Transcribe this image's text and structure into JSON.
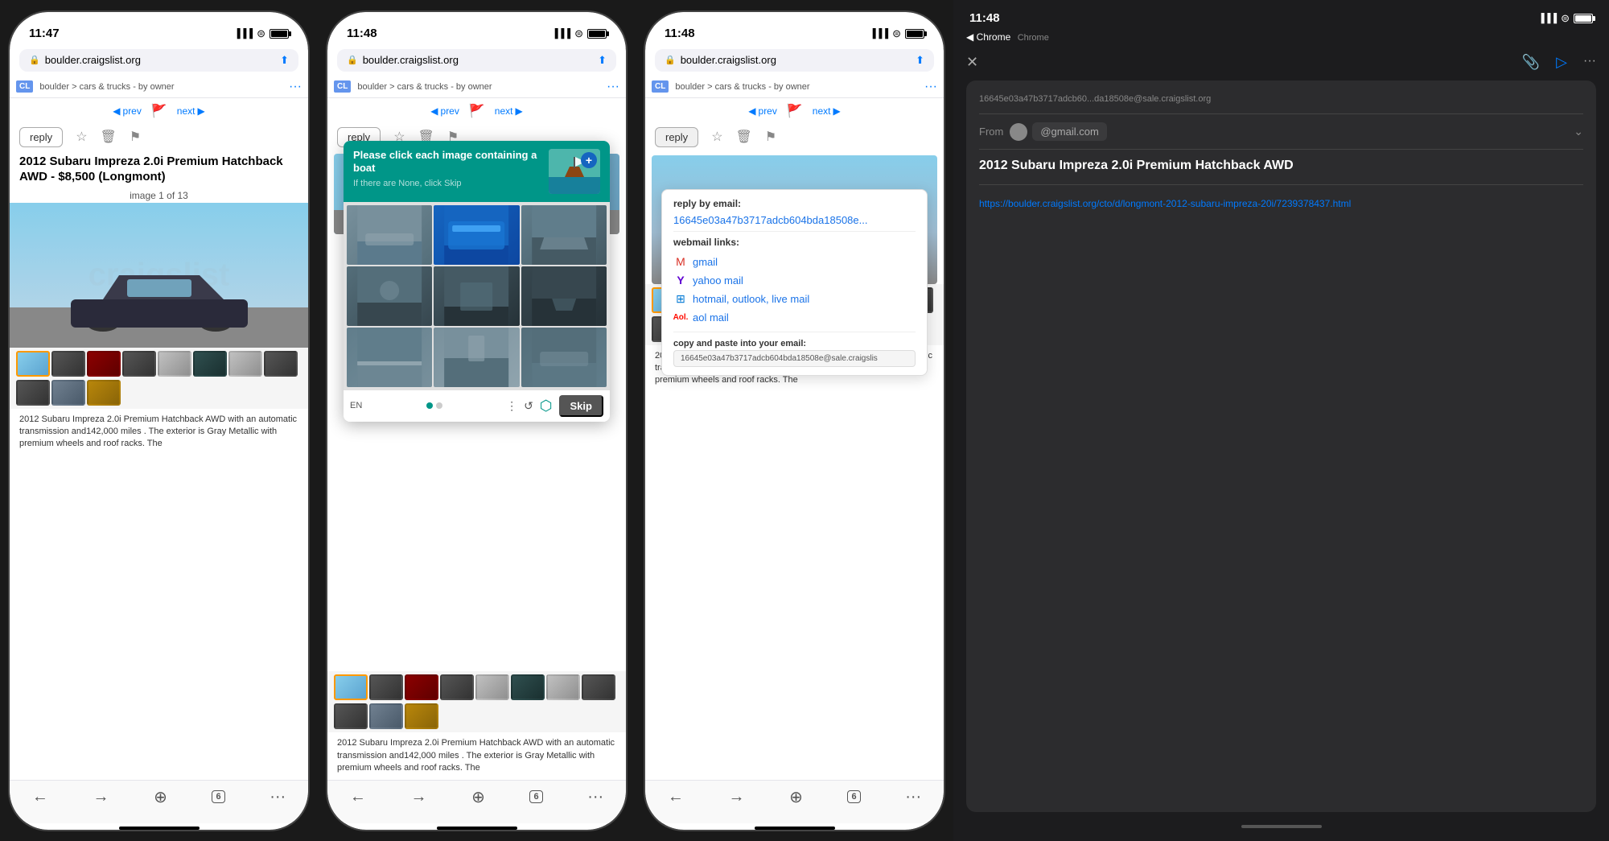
{
  "phones": [
    {
      "id": "phone1",
      "status_bar": {
        "time": "11:47",
        "signal": "●●●",
        "wifi": "WiFi",
        "battery": "full"
      },
      "url_bar": {
        "lock": "🔒",
        "url": "boulder.craigslist.org",
        "share": "⬆"
      },
      "breadcrumb": "boulder > cars & trucks - by owner",
      "prev_label": "prev",
      "next_label": "next",
      "reply_label": "reply",
      "listing_title": "2012 Subaru Impreza 2.0i Premium Hatchback AWD - $8,500 (Longmont)",
      "image_counter": "image 1 of 13",
      "description": "2012 Subaru Impreza 2.0i Premium Hatchback AWD with an automatic transmission and142,000 miles . The exterior is Gray Metallic with premium wheels and roof racks. The",
      "bottom_nav": {
        "back": "←",
        "forward": "→",
        "share": "+",
        "tabs": "6",
        "more": "···"
      }
    },
    {
      "id": "phone2",
      "status_bar": {
        "time": "11:48"
      },
      "url_bar": {
        "url": "boulder.craigslist.org"
      },
      "captcha": {
        "header_text": "Please click each image containing a boat",
        "subtext": "If there are None, click Skip",
        "skip_label": "Skip",
        "lang": "EN"
      }
    },
    {
      "id": "phone3",
      "status_bar": {
        "time": "11:48"
      },
      "url_bar": {
        "url": "boulder.craigslist.org"
      },
      "reply_dropdown": {
        "label": "reply by email:",
        "email_link": "16645e03a47b3717adcb604bda18508e...",
        "webmail_label": "webmail links:",
        "gmail": "gmail",
        "yahoo": "yahoo mail",
        "hotmail": "hotmail, outlook, live mail",
        "aol": "aol mail",
        "copy_label": "copy and paste into your email:",
        "copy_email": "16645e03a47b3717adcb604bda18508e@sale.craigslis"
      }
    }
  ],
  "email_panel": {
    "status_bar": {
      "time": "11:48",
      "chrome_label": "Chrome"
    },
    "back_label": "◀ Chrome",
    "close_icon": "✕",
    "attach_icon": "📎",
    "send_icon": "▷",
    "more_icon": "···",
    "email_header": "16645e03a47b3717adcb60...da18508e@sale.craigslist.org",
    "from_label": "From",
    "from_value": "@gmail.com",
    "email_subject": "2012 Subaru Impreza 2.0i Premium Hatchback AWD",
    "email_body_link": "https://boulder.craigslist.org/cto/d/longmont-2012-subaru-impreza-20i/7239378437.html"
  }
}
